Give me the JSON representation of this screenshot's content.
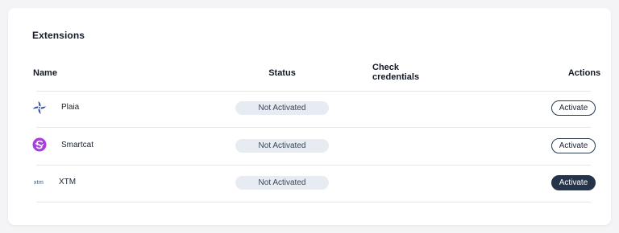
{
  "panel": {
    "title": "Extensions"
  },
  "table": {
    "columns": {
      "name": "Name",
      "status": "Status",
      "check": "Check credentials",
      "actions": "Actions"
    },
    "rows": [
      {
        "name": "Plaia",
        "icon": "plaia-logo-icon",
        "status": "Not Activated",
        "action": "Activate"
      },
      {
        "name": "Smartcat",
        "icon": "smartcat-logo-icon",
        "status": "Not Activated",
        "action": "Activate"
      },
      {
        "name": "XTM",
        "icon": "xtm-logo-icon",
        "logo_text": "xtm",
        "status": "Not Activated",
        "action": "Activate"
      }
    ]
  },
  "colors": {
    "badge_bg": "#e6ecf2",
    "button_primary": "#26344a",
    "plaia_brand": "#2e4a9a",
    "smartcat_brand": "#a83ee0"
  }
}
